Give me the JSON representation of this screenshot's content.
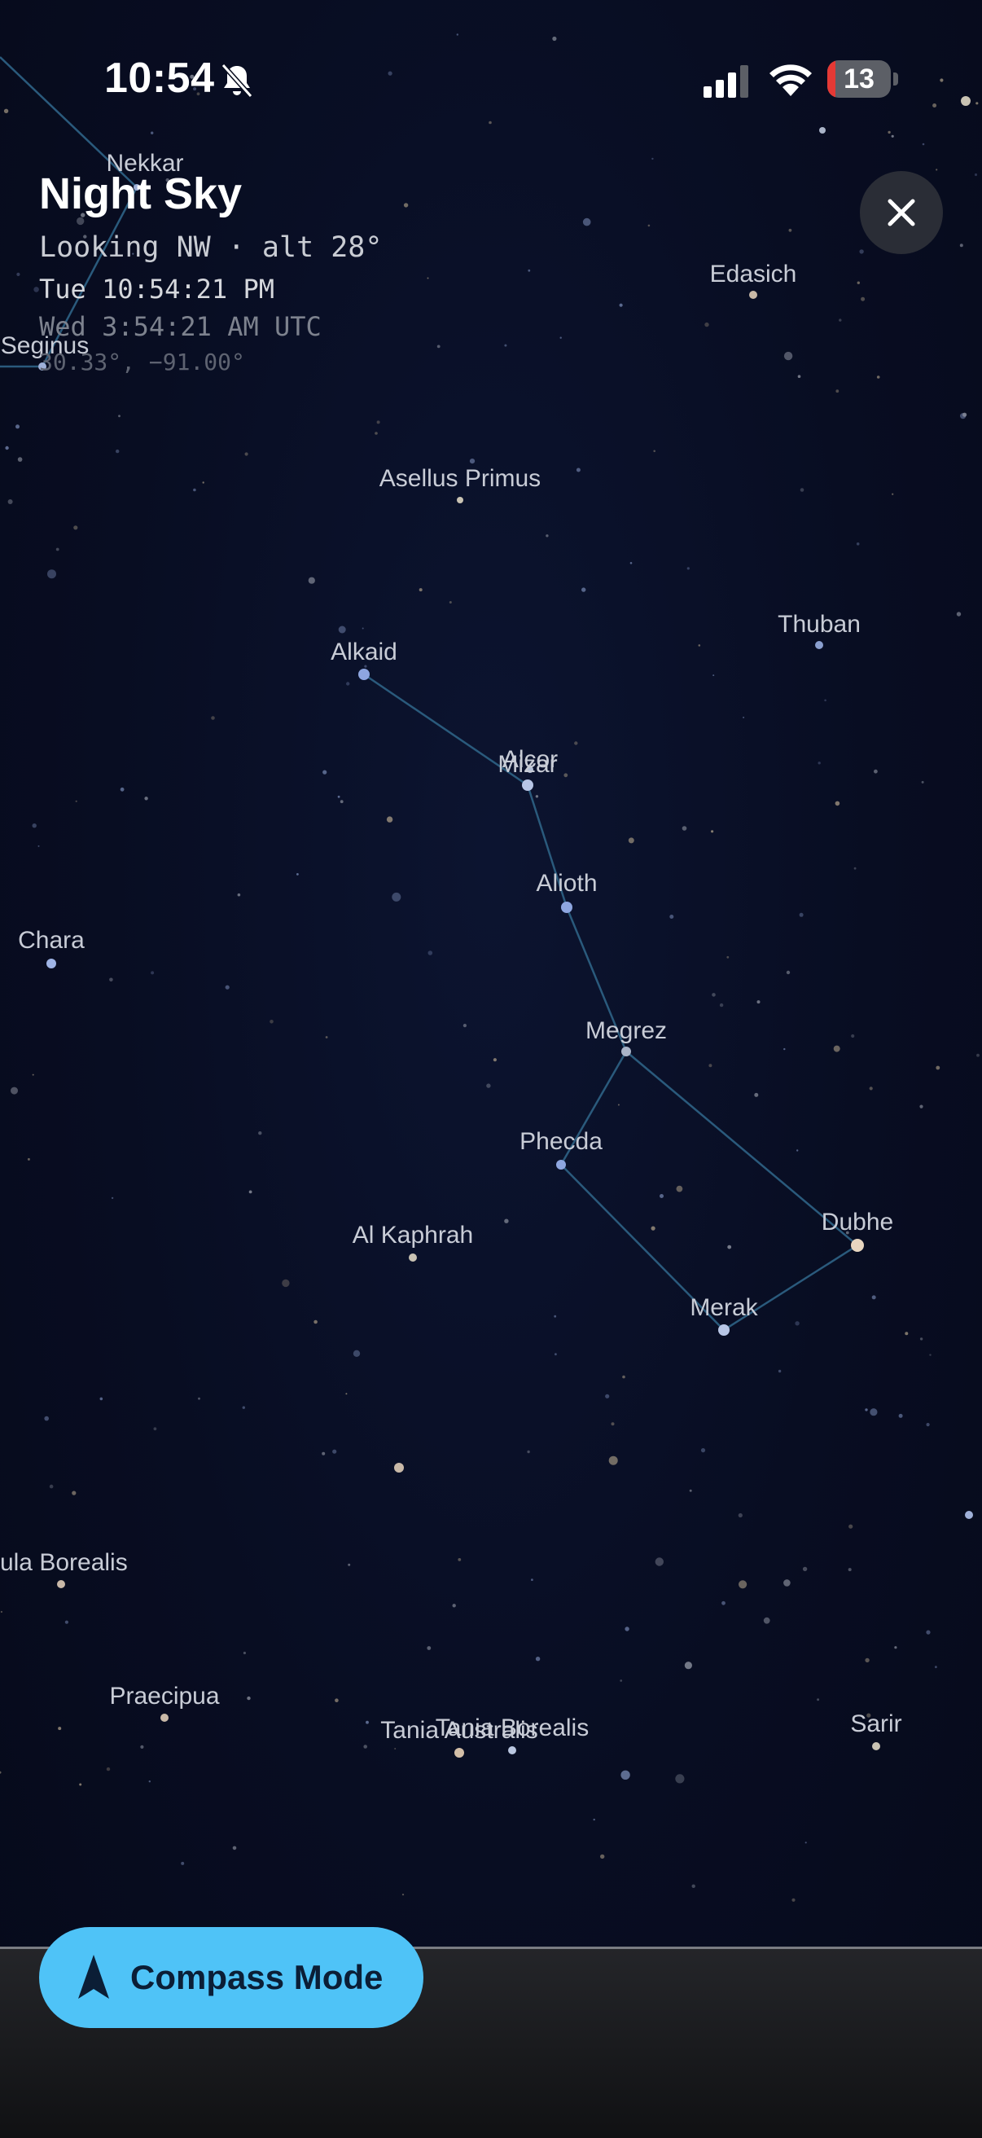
{
  "status_bar": {
    "time": "10:54",
    "battery": "13",
    "battery_level": 0.13,
    "icons": [
      "bell-slash-icon",
      "cellular-signal-icon",
      "wifi-icon",
      "battery-icon"
    ]
  },
  "header": {
    "title": "Night Sky",
    "direction": "Looking NW · alt 28°",
    "local_time": "Tue 10:54:21 PM",
    "utc_time": "Wed 3:54:21 AM UTC",
    "coordinates": "30.33°, −91.00°"
  },
  "close_button": {
    "icon": "close-icon"
  },
  "compass_button": {
    "label": "Compass Mode",
    "icon": "location-arrow-icon"
  },
  "colors": {
    "background": "#080d22",
    "constellation_line": "#2a5a7c",
    "star_label": "#c8ccd6",
    "accent": "#4fc3f7"
  },
  "stars": [
    {
      "name": "Nekkar",
      "label": "Nekkar"
    },
    {
      "name": "Seginus",
      "label": "Seginus"
    },
    {
      "name": "Edasich",
      "label": "Edasich"
    },
    {
      "name": "Asellus Primus",
      "label": "Asellus Primus"
    },
    {
      "name": "Thuban",
      "label": "Thuban"
    },
    {
      "name": "Alkaid",
      "label": "Alkaid"
    },
    {
      "name": "Alcor",
      "label": "Alcor"
    },
    {
      "name": "Mizar",
      "label": "Mizar"
    },
    {
      "name": "Alioth",
      "label": "Alioth"
    },
    {
      "name": "Chara",
      "label": "Chara"
    },
    {
      "name": "Megrez",
      "label": "Megrez"
    },
    {
      "name": "Phecda",
      "label": "Phecda"
    },
    {
      "name": "Dubhe",
      "label": "Dubhe"
    },
    {
      "name": "Al Kaphrah",
      "label": "Al Kaphrah"
    },
    {
      "name": "Merak",
      "label": "Merak"
    },
    {
      "name": "Alula Borealis",
      "label": "lula Borealis"
    },
    {
      "name": "Praecipua",
      "label": "Praecipua"
    },
    {
      "name": "Tania Australis",
      "label": "Tania Australis"
    },
    {
      "name": "Tania Borealis",
      "label": "Tania Borealis"
    },
    {
      "name": "Sarir",
      "label": "Sarir"
    }
  ],
  "constellation_lines": [
    [
      "Alkaid",
      "Mizar"
    ],
    [
      "Mizar",
      "Alioth"
    ],
    [
      "Alioth",
      "Megrez"
    ],
    [
      "Megrez",
      "Phecda"
    ],
    [
      "Phecda",
      "Merak"
    ],
    [
      "Merak",
      "Dubhe"
    ],
    [
      "Dubhe",
      "Megrez"
    ]
  ]
}
